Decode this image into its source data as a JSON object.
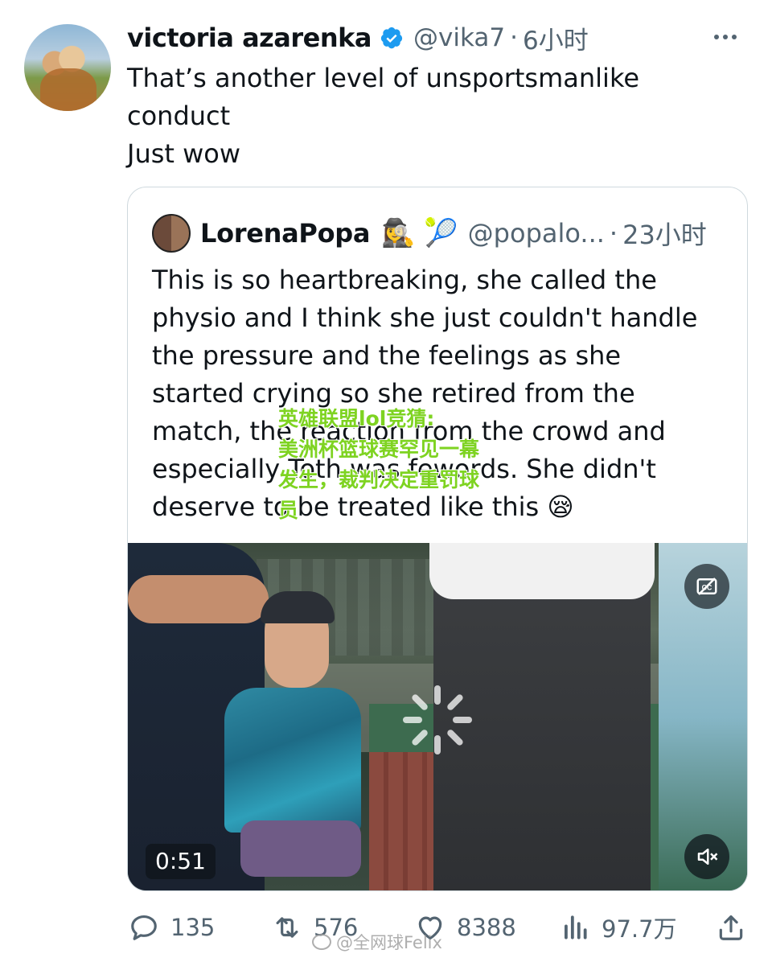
{
  "tweet": {
    "display_name": "victoria azarenka",
    "handle": "@vika7",
    "time_sep": "·",
    "time": "6小时",
    "text_lines": [
      "That’s another level of unsportsmanlike",
      "conduct",
      "Just wow"
    ]
  },
  "quote": {
    "display_name": "LorenaPopa",
    "emojis": "🕵️‍♀️ 🎾",
    "handle": "@popalo...",
    "time_sep": "·",
    "time": "23小时",
    "text_lines": [
      "This is so heartbreaking, she called the",
      "physio and I think she just couldn't handle",
      "the pressure and the feelings as she",
      "started crying so she retired from the",
      "match, the reaction from the crowd and",
      "especially Toth was fewords. She didn't",
      "deserve to be treated like this 😪"
    ],
    "video": {
      "duration": "0:51"
    }
  },
  "overlay_lines": [
    "英雄联盟lol竞猜:",
    "美洲杯篮球赛罕见一幕",
    "发生，裁判决定重罚球",
    "员"
  ],
  "actions": {
    "replies": "135",
    "reposts": "576",
    "likes": "8388",
    "views": "97.7万"
  },
  "watermark": "@全网球Felix",
  "colors": {
    "verified": "#1d9bf0",
    "secondary_text": "#536471",
    "overlay_text": "#7ed321"
  }
}
